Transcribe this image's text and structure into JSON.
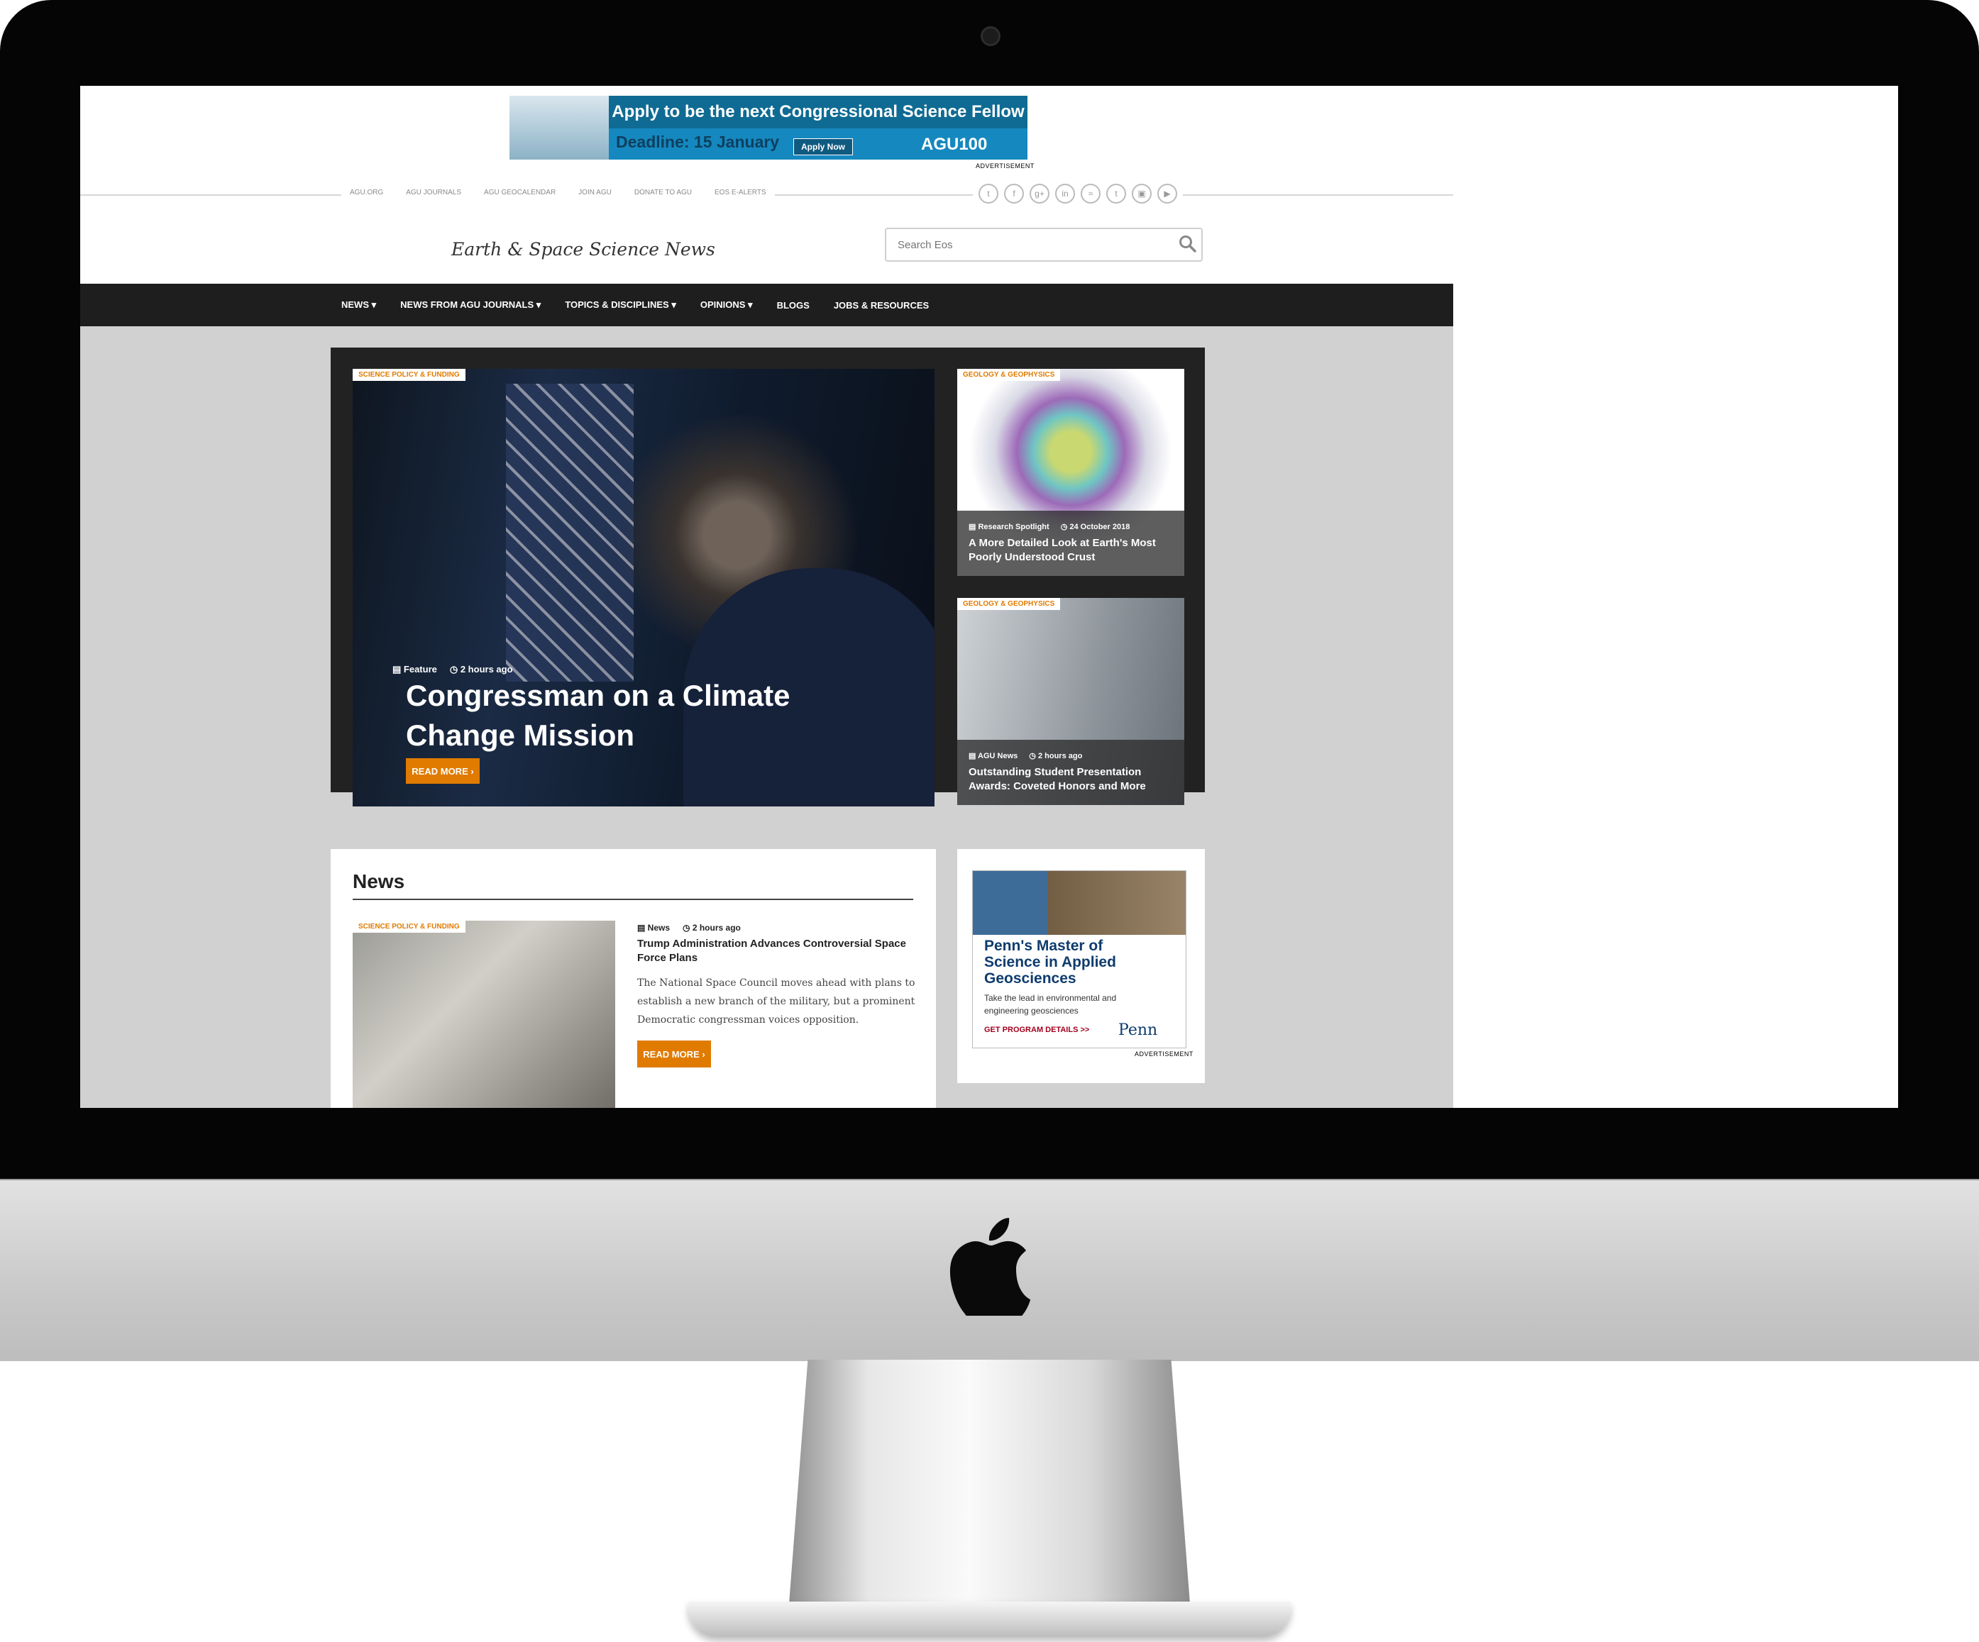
{
  "ad_banner": {
    "headline": "Apply to be the next Congressional Science Fellow",
    "deadline": "Deadline: 15 January",
    "button": "Apply Now",
    "brand": "AGU100",
    "label": "ADVERTISEMENT"
  },
  "top_links": [
    "AGU.ORG",
    "AGU JOURNALS",
    "AGU GEOCALENDAR",
    "JOIN AGU",
    "DONATE TO AGU",
    "EOS E-ALERTS"
  ],
  "social_icons": [
    "twitter-icon",
    "facebook-icon",
    "google-plus-icon",
    "linkedin-icon",
    "rss-icon",
    "tumblr-icon",
    "instagram-icon",
    "youtube-icon"
  ],
  "header": {
    "tagline": "Earth & Space Science News",
    "search_placeholder": "Search Eos"
  },
  "nav": [
    "NEWS",
    "NEWS FROM AGU JOURNALS",
    "TOPICS & DISCIPLINES",
    "OPINIONS",
    "BLOGS",
    "JOBS & RESOURCES"
  ],
  "featured": {
    "main": {
      "category": "SCIENCE POLICY & FUNDING",
      "type": "Feature",
      "time": "2 hours ago",
      "title": "Congressman on a Climate Change Mission",
      "read_more": "READ MORE ›"
    },
    "side": [
      {
        "category": "GEOLOGY & GEOPHYSICS",
        "type": "Research Spotlight",
        "time": "24 October 2018",
        "title": "A More Detailed Look at Earth's Most Poorly Understood Crust"
      },
      {
        "category": "GEOLOGY & GEOPHYSICS",
        "type": "AGU News",
        "time": "2 hours ago",
        "title": "Outstanding Student Presentation Awards: Coveted Honors and More"
      }
    ]
  },
  "news": {
    "heading": "News",
    "category": "SCIENCE POLICY & FUNDING",
    "type": "News",
    "time": "2 hours ago",
    "title": "Trump Administration Advances Controversial Space Force Plans",
    "summary": "The National Space Council moves ahead with plans to establish a new branch of the military, but a prominent Democratic congressman voices opposition.",
    "read_more": "READ MORE ›"
  },
  "penn_ad": {
    "headline": "Penn's Master of Science in Applied Geosciences",
    "subtext": "Take the lead in environmental and engineering geosciences",
    "cta": "GET PROGRAM DETAILS >>",
    "logo": "Penn",
    "label": "ADVERTISEMENT"
  },
  "colors": {
    "accent_orange": "#e07b00",
    "nav_bg": "#1e1e1e",
    "page_gray": "#d1d1d1"
  }
}
